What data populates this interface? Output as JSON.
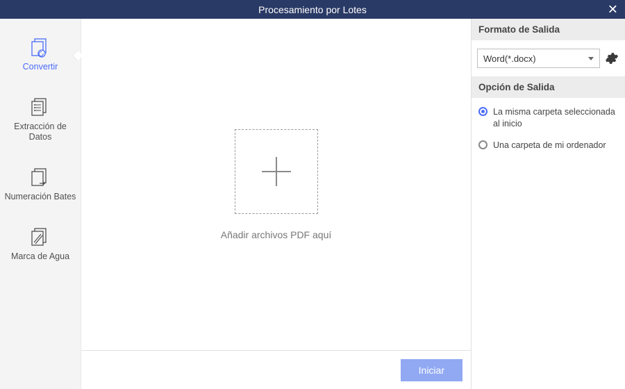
{
  "title": "Procesamiento por Lotes",
  "sidebar": {
    "items": [
      {
        "label": "Convertir"
      },
      {
        "label": "Extracción de Datos"
      },
      {
        "label": "Numeración Bates"
      },
      {
        "label": "Marca de Agua"
      }
    ]
  },
  "drop_label": "Añadir archivos PDF aquí",
  "footer": {
    "start_label": "Iniciar"
  },
  "right": {
    "format_title": "Formato de Salida",
    "format_selected": "Word(*.docx)",
    "option_title": "Opción de Salida",
    "options": [
      "La misma carpeta seleccionada al inicio",
      "Una carpeta de mi ordenador"
    ]
  }
}
